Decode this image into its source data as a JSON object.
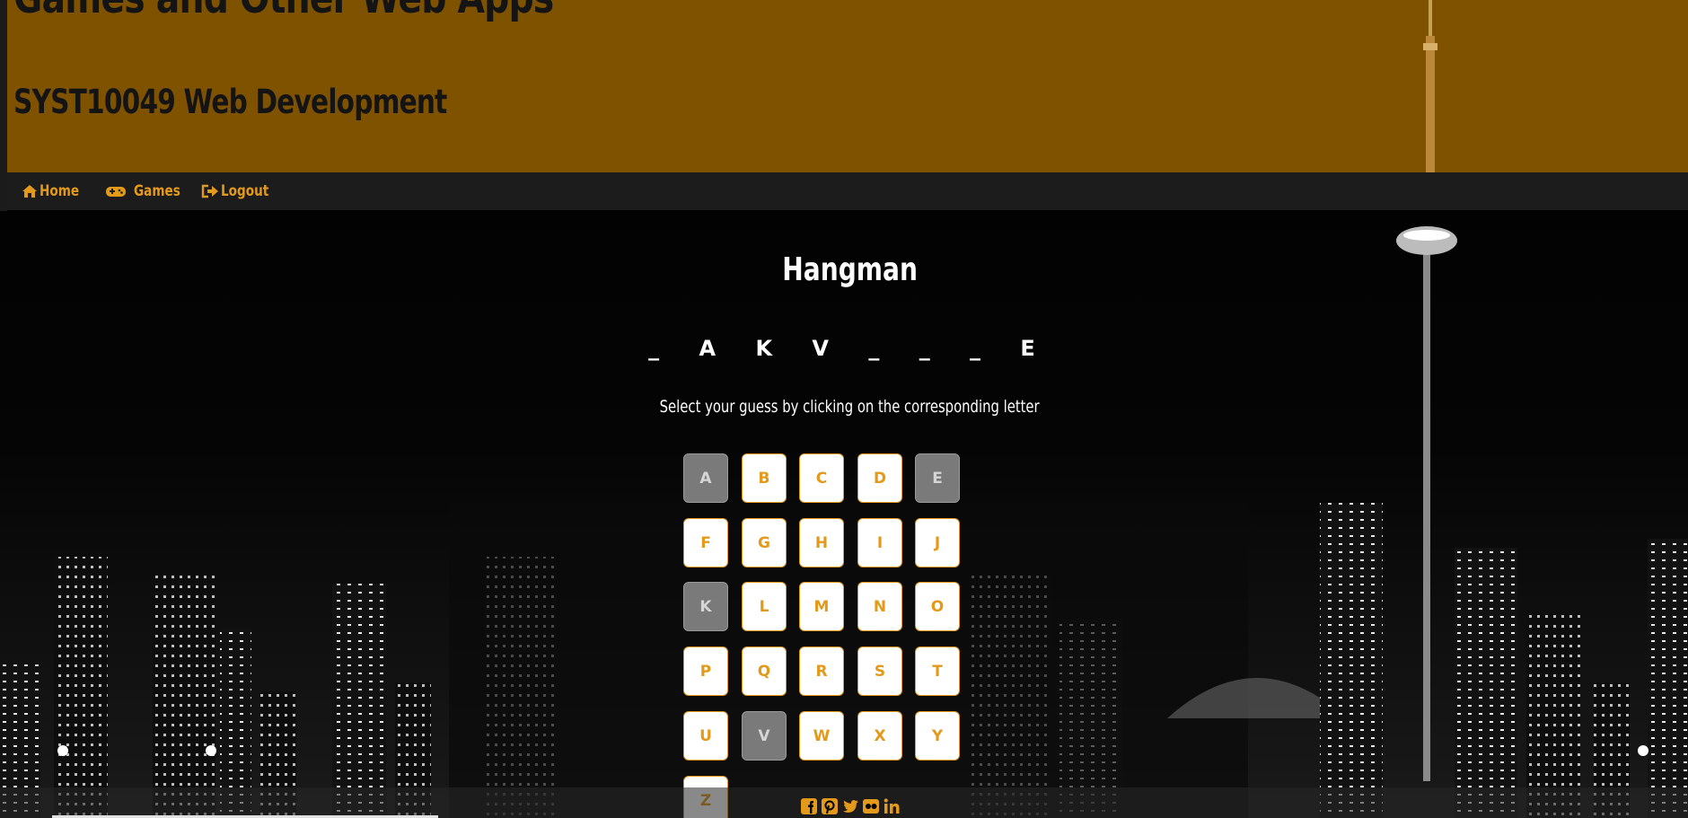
{
  "header": {
    "site_title": "Games and Other Web Apps",
    "course_title": "SYST10049 Web Development"
  },
  "nav": {
    "home": "Home",
    "games": "Games",
    "logout": "Logout"
  },
  "main": {
    "title": "Hangman",
    "word_display": "_ A K V _ _ _ E",
    "instructions": "Select your guess by clicking on the corresponding letter"
  },
  "letters": [
    {
      "letter": "A",
      "guessed": true
    },
    {
      "letter": "B",
      "guessed": false
    },
    {
      "letter": "C",
      "guessed": false
    },
    {
      "letter": "D",
      "guessed": false
    },
    {
      "letter": "E",
      "guessed": true
    },
    {
      "letter": "F",
      "guessed": false
    },
    {
      "letter": "G",
      "guessed": false
    },
    {
      "letter": "H",
      "guessed": false
    },
    {
      "letter": "I",
      "guessed": false
    },
    {
      "letter": "J",
      "guessed": false
    },
    {
      "letter": "K",
      "guessed": true
    },
    {
      "letter": "L",
      "guessed": false
    },
    {
      "letter": "M",
      "guessed": false
    },
    {
      "letter": "N",
      "guessed": false
    },
    {
      "letter": "O",
      "guessed": false
    },
    {
      "letter": "P",
      "guessed": false
    },
    {
      "letter": "Q",
      "guessed": false
    },
    {
      "letter": "R",
      "guessed": false
    },
    {
      "letter": "S",
      "guessed": false
    },
    {
      "letter": "T",
      "guessed": false
    },
    {
      "letter": "U",
      "guessed": false
    },
    {
      "letter": "V",
      "guessed": true
    },
    {
      "letter": "W",
      "guessed": false
    },
    {
      "letter": "X",
      "guessed": false
    },
    {
      "letter": "Y",
      "guessed": false
    },
    {
      "letter": "Z",
      "guessed": false
    }
  ],
  "footer": {
    "social_icons": [
      "facebook-icon",
      "pinterest-icon",
      "twitter-icon",
      "flickr-icon",
      "linkedin-icon"
    ]
  },
  "colors": {
    "header_bg": "#7f5200",
    "nav_bg": "#1c1c1c",
    "accent": "#e39a1a",
    "guessed_bg": "#7a7a7a"
  }
}
